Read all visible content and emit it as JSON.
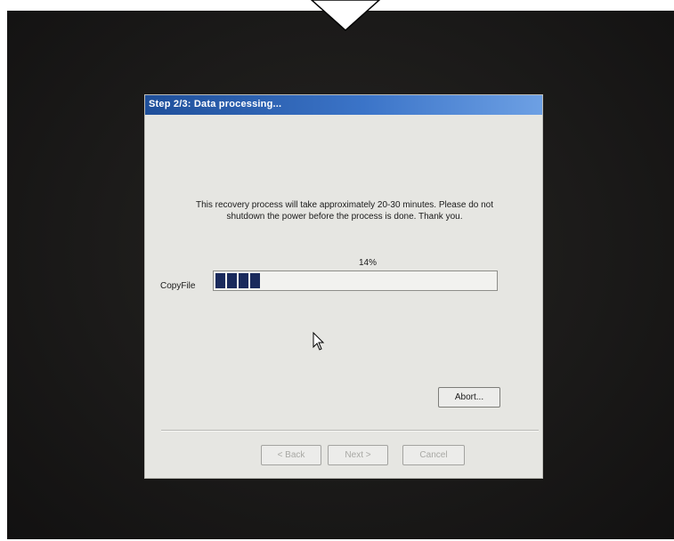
{
  "wizard": {
    "title": "Step 2/3: Data processing...",
    "message_line1": "This recovery process will take approximately 20-30 minutes.  Please do not",
    "message_line2": "shutdown the power before the process is done.  Thank you.",
    "progress_label": "CopyFile",
    "progress_percent_text": "14%",
    "progress_fraction": 0.14,
    "abort_label": "Abort...",
    "back_label": "< Back",
    "next_label": "Next >",
    "cancel_label": "Cancel"
  },
  "icons": {
    "cursor": "mouse-pointer-icon",
    "annotation": "down-triangle-icon"
  },
  "colors": {
    "titlebar": "#1f4f9a",
    "progress_fill": "#1a2a5c",
    "dialog_bg": "#e6e6e2",
    "screen_bg": "#1b1a19"
  }
}
